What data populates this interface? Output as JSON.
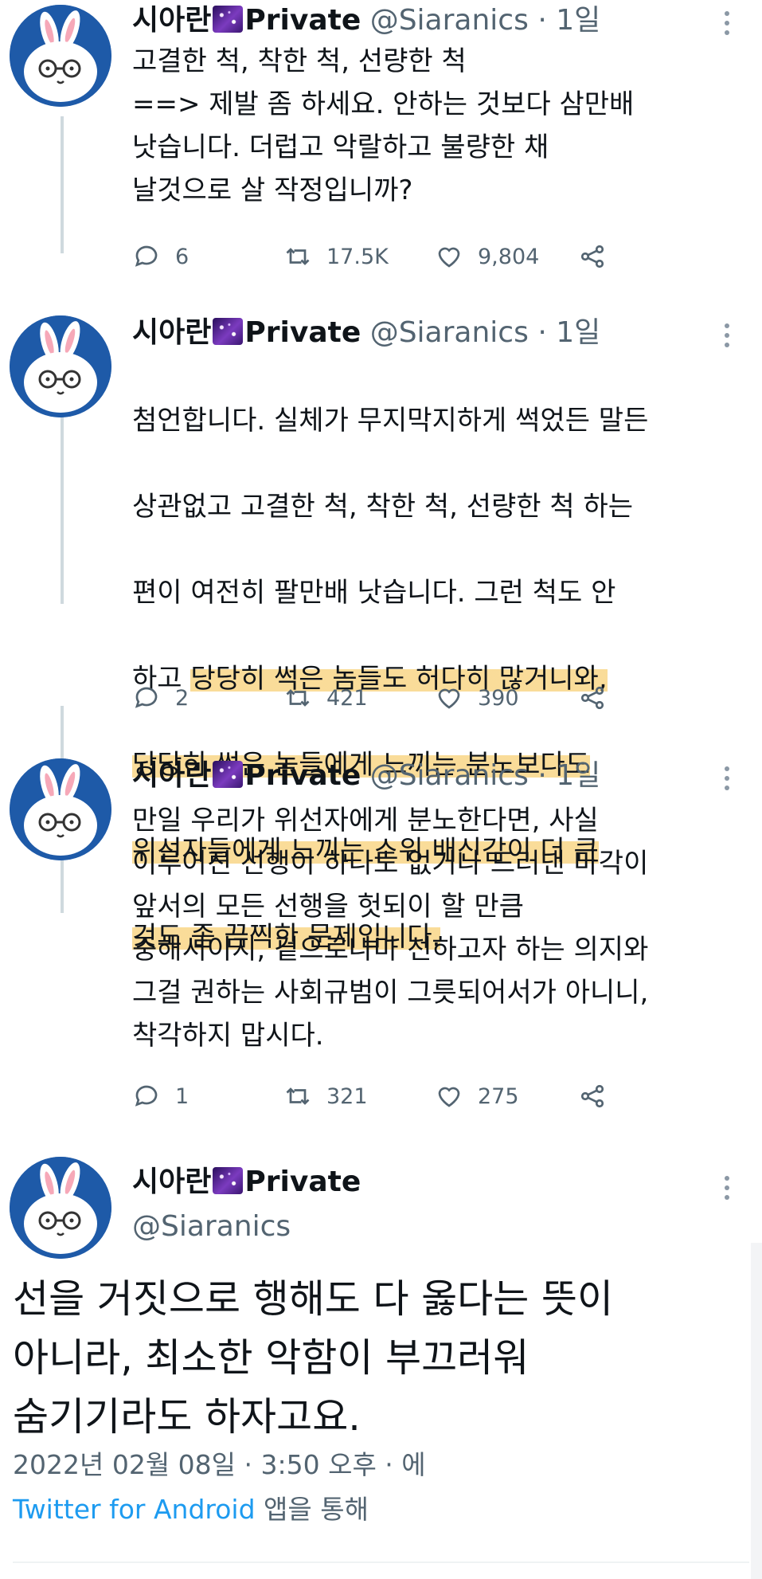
{
  "tweets": [
    {
      "name": "시아란",
      "suffix": "Private",
      "handle": "@Siaranics",
      "time": "· 1일",
      "lines": "고결한 척, 착한 척, 선량한 척\n==> 제발 좀 하세요. 안하는 것보다 삼만배\n낫습니다. 더럽고 악랄하고 불량한 채\n날것으로 살 작정입니까?",
      "replies": "6",
      "retweets": "17.5K",
      "likes": "9,804"
    },
    {
      "name": "시아란",
      "suffix": "Private",
      "handle": "@Siaranics",
      "time": "· 1일",
      "line1": "첨언합니다. 실체가 무지막지하게 썩었든 말든",
      "line2": "상관없고 고결한 척, 착한 척, 선량한 척 하는",
      "line3": "편이 여전히 팔만배 낫습니다. 그런 척도 안",
      "line4_plain": "하고 ",
      "line4_hl": "당당히 썩은 놈들도 허다히 많거니와,",
      "line5_hl": "당당히 썩은 놈들에게 느끼는 분노보다도",
      "line6_hl": "위선자들에게 느끼는 소위 배신감이 더 큰",
      "line7_hl": "것도 좀 끔찍한 문제입니다.",
      "replies": "2",
      "retweets": "421",
      "likes": "390"
    },
    {
      "name": "시아란",
      "suffix": "Private",
      "handle": "@Siaranics",
      "time": "· 1일",
      "lines": "만일 우리가 위선자에게 분노한다면, 사실\n이루어진 선행이 하나도 없거나 드러낸 마각이\n앞서의 모든 선행을 헛되이 할 만큼\n중해서이지, 겉으로나마 선하고자 하는 의지와\n그걸 권하는 사회규범이 그릇되어서가 아니니,\n착각하지 맙시다.",
      "replies": "1",
      "retweets": "321",
      "likes": "275"
    }
  ],
  "main": {
    "name": "시아란",
    "suffix": "Private",
    "handle": "@Siaranics",
    "text": "선을 거짓으로 행해도 다 옳다는 뜻이\n아니라, 최소한 악함이 부끄러워\n숨기기라도 하자고요.",
    "datetime": "2022년 02월 08일 · 3:50 오후 · 에",
    "source_app": "Twitter for Android",
    "source_suffix": " 앱을 통해"
  },
  "icons": {
    "reply": "speech-bubble-icon",
    "retweet": "retweet-arrows-icon",
    "like": "heart-icon",
    "share": "share-nodes-icon",
    "more": "vertical-dots-icon",
    "emoji": "milky-way-emoji"
  },
  "colors": {
    "text": "#0f1419",
    "muted": "#536471",
    "link": "#1d9bf0",
    "highlight": "#f7cd6e",
    "avatar_bg": "#1e5aa8",
    "thread_line": "#cfd9de"
  }
}
